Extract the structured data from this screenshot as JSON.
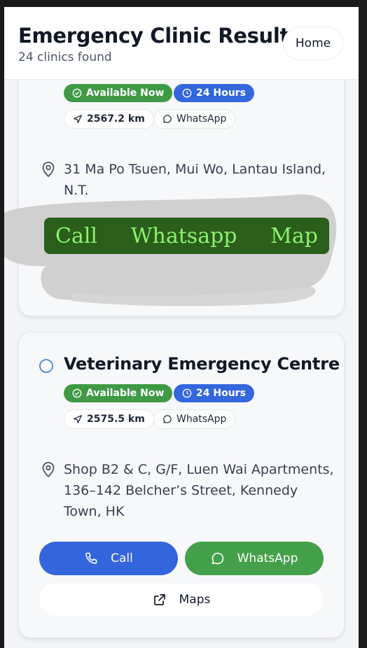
{
  "header": {
    "title": "Emergency Clinic Results",
    "subtitle": "24 clinics found",
    "home_label": "Home"
  },
  "clinics": [
    {
      "name": "",
      "badges": {
        "available": "Available Now",
        "hours": "24 Hours"
      },
      "distance": "2567.2 km",
      "whatsapp_chip": "WhatsApp",
      "address": [
        "31 Ma Po Tsuen, Mui Wo, Lantau Island,",
        "N.T."
      ]
    },
    {
      "name": "Veterinary Emergency Centre",
      "badges": {
        "available": "Available Now",
        "hours": "24 Hours"
      },
      "distance": "2575.5 km",
      "whatsapp_chip": "WhatsApp",
      "address": [
        "Shop B2 & C, G/F, Luen Wai Apartments,",
        "136–142 Belcher’s Street, Kennedy",
        "Town, HK"
      ],
      "actions": {
        "call": "Call",
        "whatsapp": "WhatsApp",
        "maps": "Maps"
      }
    }
  ],
  "annotation_overlay": {
    "call": "Call",
    "whatsapp": "Whatsapp",
    "map": "Map"
  },
  "colors": {
    "available_green": "#3f9a45",
    "hours_blue": "#3466dc",
    "call_blue": "#3465dc",
    "whatsapp_green": "#45a04b",
    "overlay_bg": "#2a5e1a",
    "overlay_text": "#8df26d"
  },
  "icons": [
    "check-circle-icon",
    "clock-icon",
    "navigation-arrow-icon",
    "chat-bubble-icon",
    "map-pin-icon",
    "phone-icon",
    "external-link-icon",
    "radio-button"
  ]
}
